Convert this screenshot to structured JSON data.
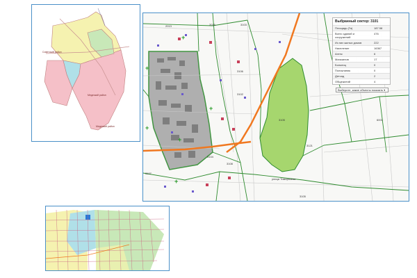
{
  "district_map": {
    "labels": [
      "Советский район",
      "Медеский район",
      "Медеский район"
    ]
  },
  "main_map": {
    "sector_labels": [
      "2013",
      "2016",
      "3103",
      "3106",
      "3102",
      "3105",
      "3121",
      "3108",
      "3107",
      "3105",
      "3104",
      "6001"
    ],
    "street_labels": [
      "улица Тимирязева"
    ],
    "info_panel": {
      "title": "Выбранный сектор: 3101",
      "rows": [
        {
          "key": "Площадь (Га)",
          "value": "187.58"
        },
        {
          "key": "Всего зданий и сооружений",
          "value": "476"
        },
        {
          "key": "Из них жилых домов",
          "value": "222"
        },
        {
          "key": "Население",
          "value": "16367"
        },
        {
          "key": "Аптек",
          "value": "6"
        },
        {
          "key": "Магазинов",
          "value": "17"
        },
        {
          "key": "Больниц",
          "value": "0"
        },
        {
          "key": "Поликлиник",
          "value": "0"
        },
        {
          "key": "Детсад",
          "value": "2"
        },
        {
          "key": "Общежитий",
          "value": "4"
        }
      ],
      "select_label": "Выберите, какие объекты показать ▾"
    }
  },
  "colors": {
    "panel_border": "#4a90c8",
    "sector_border": "#2e8b2e",
    "main_road": "#f07820",
    "park": "#a6d66e",
    "selected_sector": "#a8a8a8",
    "district_yellow": "#f5f2b0",
    "district_pink": "#f5c0c8",
    "district_green": "#c8e8b8",
    "district_cyan": "#b0e0e8"
  }
}
